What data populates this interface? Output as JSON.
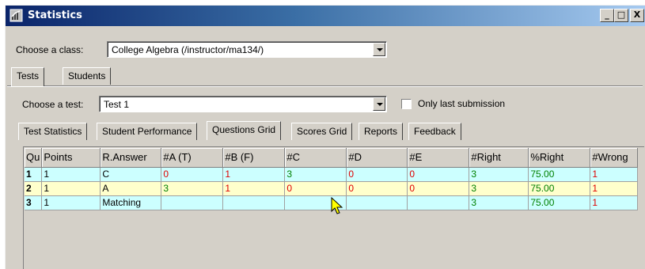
{
  "window": {
    "title": "Statistics",
    "buttons": {
      "minimize": "_",
      "maximize": "□",
      "close": "X"
    }
  },
  "class_selector": {
    "label": "Choose a class:",
    "value": "College Algebra (/instructor/ma134/)"
  },
  "main_tabs": [
    {
      "label": "Tests"
    },
    {
      "label": "Students"
    }
  ],
  "test_selector": {
    "label": "Choose a test:",
    "value": "Test 1"
  },
  "only_last_submission": {
    "label": "Only last submission",
    "checked": false
  },
  "sub_tabs": [
    {
      "label": "Test Statistics"
    },
    {
      "label": "Student Performance"
    },
    {
      "label": "Questions Grid"
    },
    {
      "label": "Scores Grid"
    },
    {
      "label": "Reports"
    },
    {
      "label": "Feedback"
    }
  ],
  "grid": {
    "columns": [
      "Qu",
      "Points",
      "R.Answer",
      "#A (T)",
      "#B (F)",
      "#C",
      "#D",
      "#E",
      "#Right",
      "%Right",
      "#Wrong"
    ],
    "rows": [
      {
        "q": "1",
        "points": "1",
        "answer": "C",
        "a": "0",
        "b": "1",
        "c": "3",
        "d": "0",
        "e": "0",
        "right": "3",
        "pct": "75.00",
        "wrong": "1"
      },
      {
        "q": "2",
        "points": "1",
        "answer": "A",
        "a": "3",
        "b": "1",
        "c": "0",
        "d": "0",
        "e": "0",
        "right": "3",
        "pct": "75.00",
        "wrong": "1"
      },
      {
        "q": "3",
        "points": "1",
        "answer": "Matching",
        "a": "",
        "b": "",
        "c": "",
        "d": "",
        "e": "",
        "right": "3",
        "pct": "75.00",
        "wrong": "1"
      }
    ]
  },
  "colors": {
    "correct": "#008000",
    "incorrect": "#e00000",
    "row_cyan": "#ccffff",
    "row_yellow": "#ffffcc"
  }
}
